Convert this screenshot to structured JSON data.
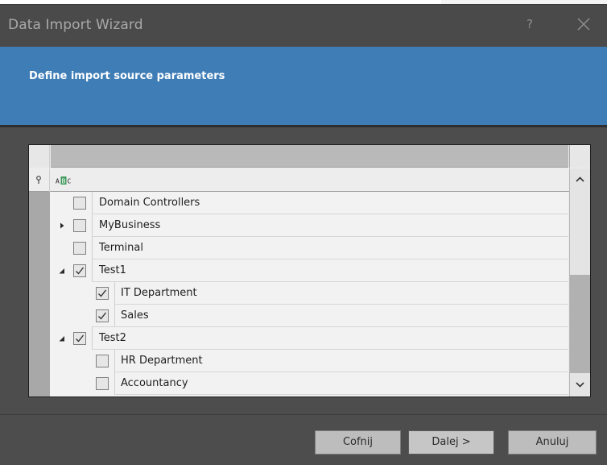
{
  "window": {
    "title": "Data Import Wizard",
    "help_glyph": "?",
    "accent_color": "#3f7db7"
  },
  "header": {
    "title": "Define import source parameters"
  },
  "grid": {
    "filter_icon": "pin-icon",
    "filter_abc_icon": "abc-text-filter-icon",
    "rows": [
      {
        "label": "Domain Controllers",
        "level": 0,
        "expander": "none",
        "checked": false
      },
      {
        "label": "MyBusiness",
        "level": 0,
        "expander": "collapsed",
        "checked": false
      },
      {
        "label": "Terminal",
        "level": 0,
        "expander": "none",
        "checked": false
      },
      {
        "label": "Test1",
        "level": 0,
        "expander": "expanded",
        "checked": true
      },
      {
        "label": "IT Department",
        "level": 1,
        "expander": "none",
        "checked": true
      },
      {
        "label": "Sales",
        "level": 1,
        "expander": "none",
        "checked": true
      },
      {
        "label": "Test2",
        "level": 0,
        "expander": "expanded",
        "checked": true
      },
      {
        "label": "HR Department",
        "level": 1,
        "expander": "none",
        "checked": false
      },
      {
        "label": "Accountancy",
        "level": 1,
        "expander": "none",
        "checked": false
      }
    ]
  },
  "footer": {
    "back_label": "Cofnij",
    "next_label": "Dalej >",
    "cancel_label": "Anuluj"
  }
}
